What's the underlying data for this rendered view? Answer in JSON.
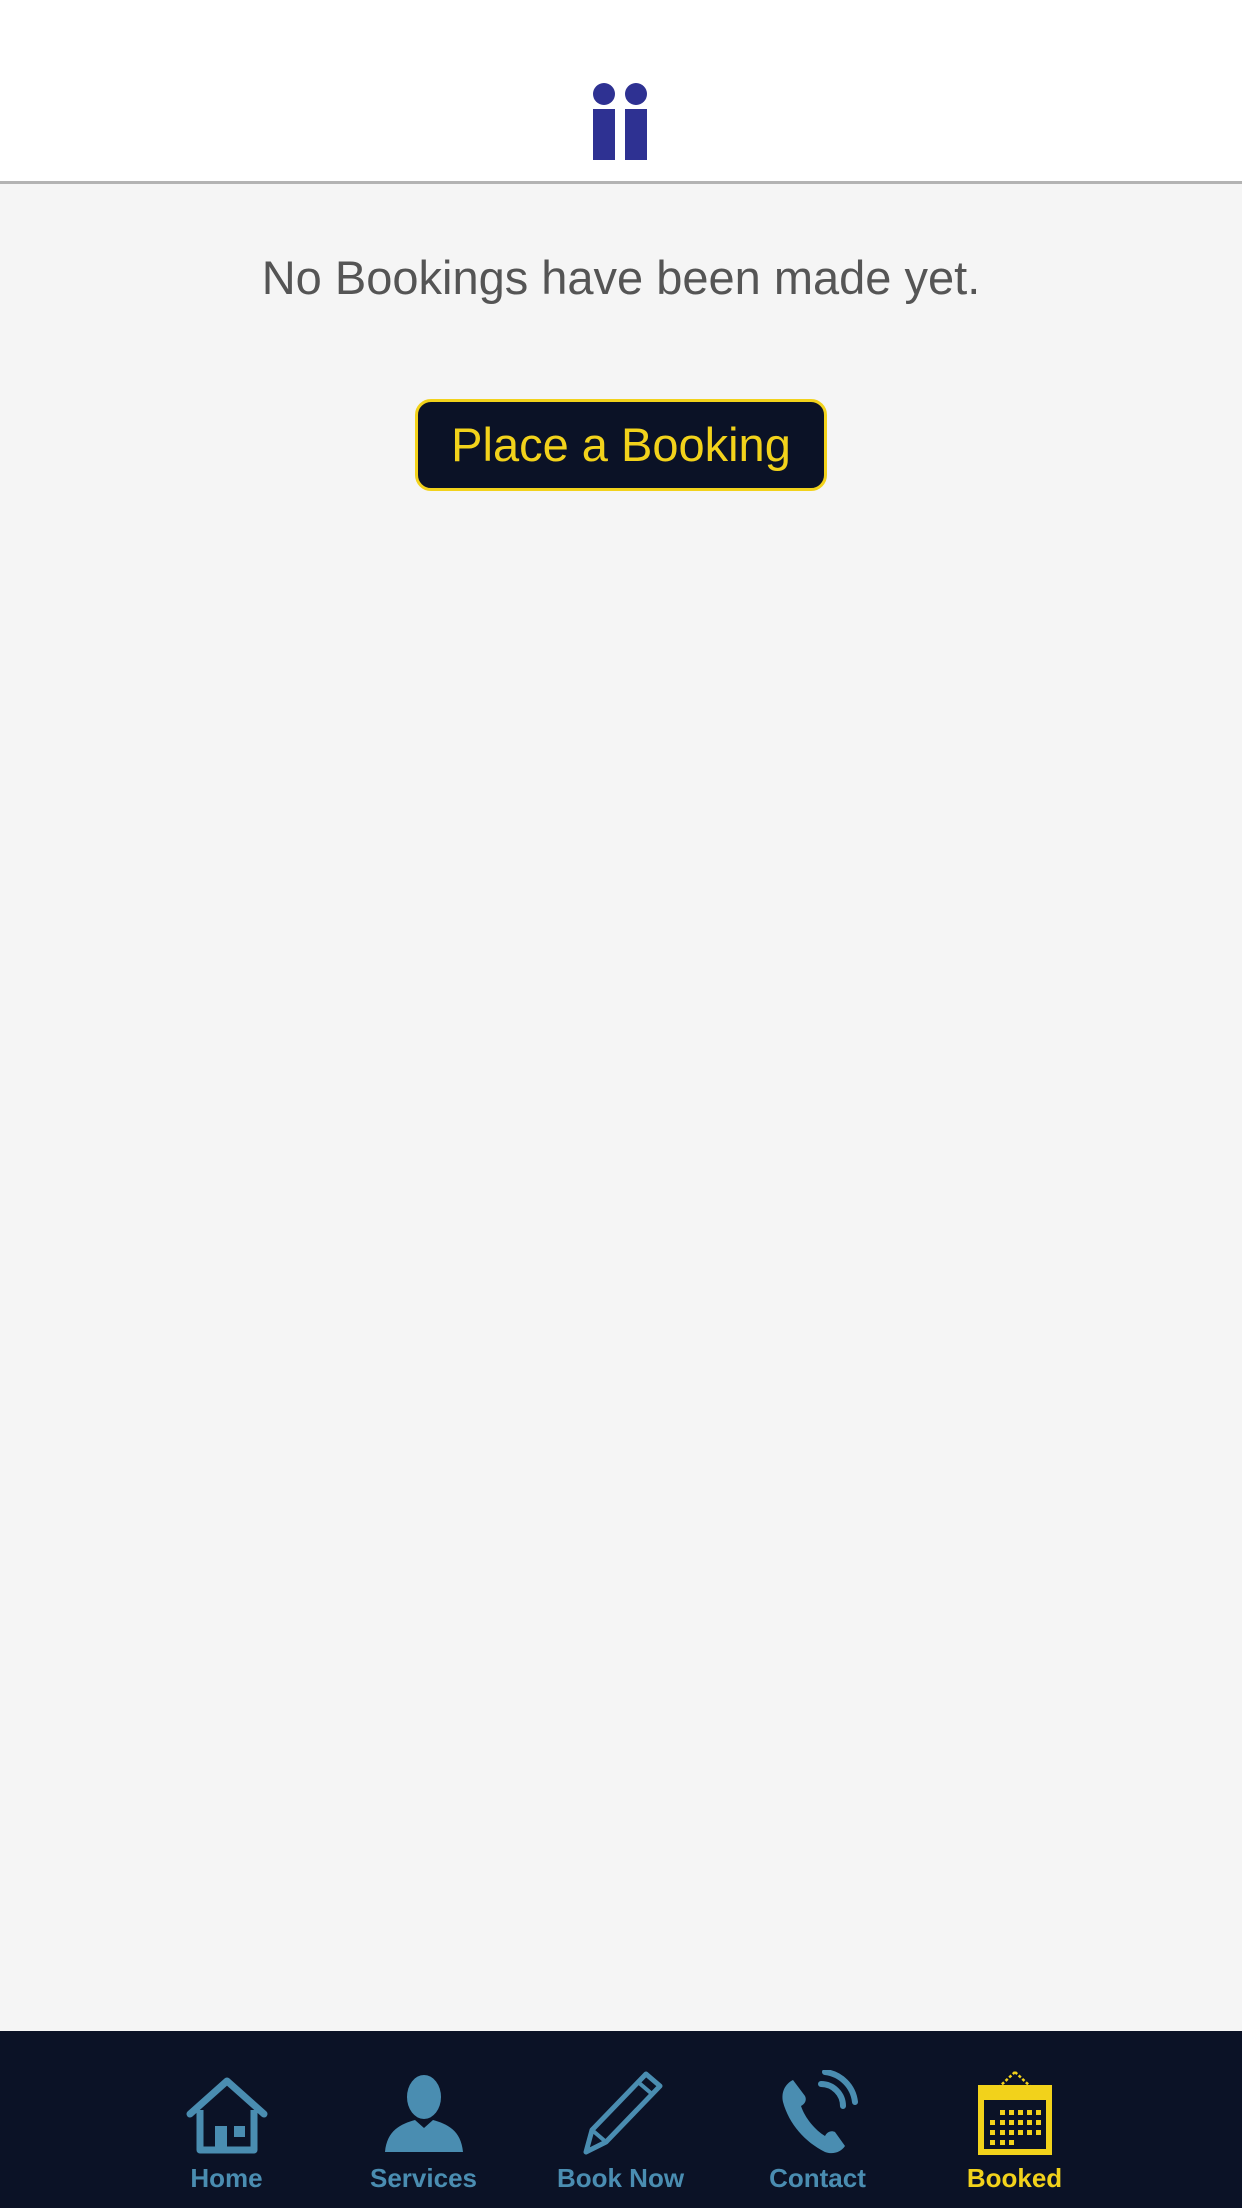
{
  "main": {
    "empty_message": "No Bookings have been made yet.",
    "place_booking_label": "Place a Booking"
  },
  "header": {
    "logo_icon": "two-people-logo-icon",
    "logo_color": "#2e3192"
  },
  "tabbar": {
    "items": [
      {
        "label": "Home",
        "icon": "home-icon",
        "active": false
      },
      {
        "label": "Services",
        "icon": "person-icon",
        "active": false
      },
      {
        "label": "Book Now",
        "icon": "pencil-icon",
        "active": false
      },
      {
        "label": "Contact",
        "icon": "phone-icon",
        "active": false
      },
      {
        "label": "Booked",
        "icon": "calendar-icon",
        "active": true
      }
    ]
  },
  "colors": {
    "accent": "#f2d21b",
    "tab_inactive": "#4a8db1",
    "tabbar_bg": "#0b1226",
    "page_bg": "#f5f5f5"
  }
}
